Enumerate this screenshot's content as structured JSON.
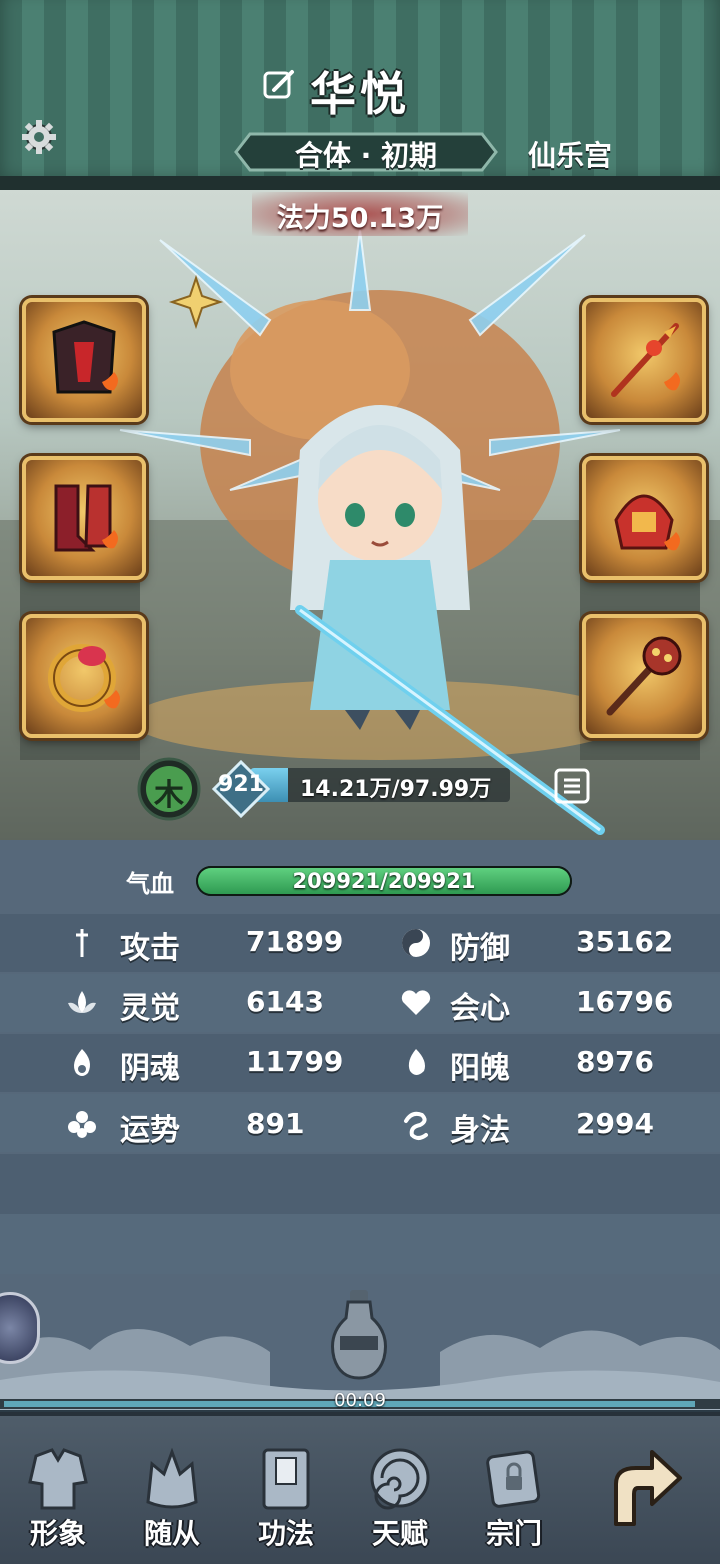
{
  "header": {
    "name": "华悦",
    "realm": "合体 · 初期",
    "sect": "仙乐宫"
  },
  "character": {
    "power": "法力50.13万",
    "element": "木",
    "level": "921",
    "cultivation": "14.21万/97.99万",
    "cultivation_fraction": 0.145
  },
  "equipment": {
    "left": [
      "armor-item",
      "boots-item",
      "ring-item"
    ],
    "right": [
      "spear-item",
      "helmet-item",
      "mace-item"
    ]
  },
  "stats": {
    "hp_label": "气血",
    "hp_value": "209921/209921",
    "hp_fraction": 1.0,
    "rows": [
      {
        "l_label": "攻击",
        "l_value": "71899",
        "r_label": "防御",
        "r_value": "35162"
      },
      {
        "l_label": "灵觉",
        "l_value": "6143",
        "r_label": "会心",
        "r_value": "16796"
      },
      {
        "l_label": "阴魂",
        "l_value": "11799",
        "r_label": "阳魄",
        "r_value": "8976"
      },
      {
        "l_label": "运势",
        "l_value": "891",
        "r_label": "身法",
        "r_value": "2994"
      }
    ]
  },
  "timer": "00:09",
  "timer_fraction": 0.97,
  "nav": {
    "items": [
      "形象",
      "随从",
      "功法",
      "天赋",
      "宗门"
    ]
  },
  "colors": {
    "header_green": "#4b8072",
    "hp_green": "#2f9a52",
    "stat_panel": "#56687a",
    "slot_gold": "#e9c06b"
  }
}
